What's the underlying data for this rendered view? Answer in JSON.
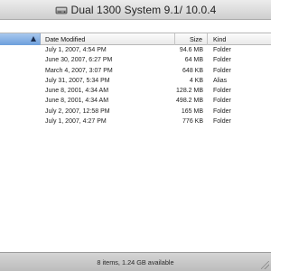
{
  "window": {
    "title": "Dual 1300 System 9.1/ 10.0.4"
  },
  "columns": {
    "date_modified": "Date Modified",
    "size": "Size",
    "kind": "Kind"
  },
  "rows": [
    {
      "date": "July 1, 2007, 4:54 PM",
      "size": "94.6 MB",
      "kind": "Folder"
    },
    {
      "date": "June 30, 2007, 6:27 PM",
      "size": "64 MB",
      "kind": "Folder"
    },
    {
      "date": "March 4, 2007, 3:07 PM",
      "size": "648 KB",
      "kind": "Folder"
    },
    {
      "date": "July 31, 2007, 5:34 PM",
      "size": "4 KB",
      "kind": "Alias"
    },
    {
      "date": "June 8, 2001, 4:34 AM",
      "size": "128.2 MB",
      "kind": "Folder"
    },
    {
      "date": "June 8, 2001, 4:34 AM",
      "size": "498.2 MB",
      "kind": "Folder"
    },
    {
      "date": "July 2, 2007, 12:58 PM",
      "size": "165 MB",
      "kind": "Folder"
    },
    {
      "date": "July 1, 2007, 4:27 PM",
      "size": "776 KB",
      "kind": "Folder"
    }
  ],
  "status": {
    "text": "8 items, 1.24 GB available"
  }
}
